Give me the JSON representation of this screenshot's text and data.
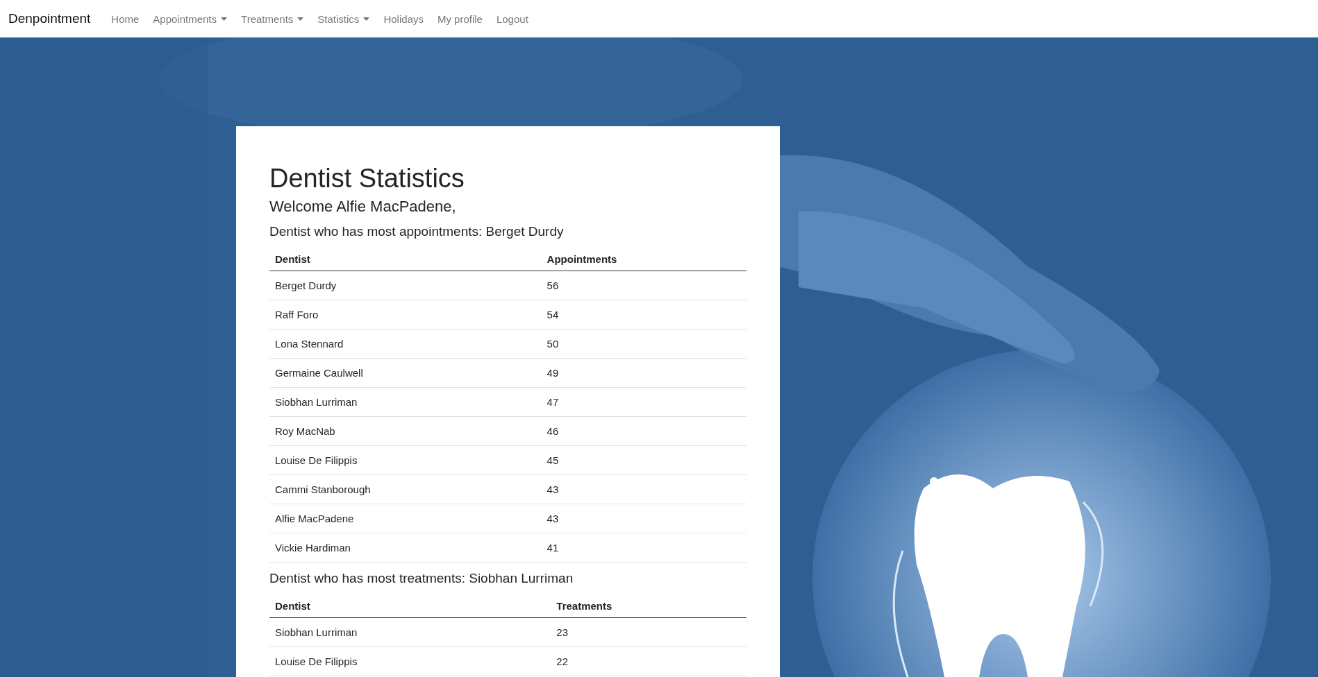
{
  "navbar": {
    "brand": "Denpointment",
    "items": [
      {
        "label": "Home",
        "dropdown": false
      },
      {
        "label": "Appointments",
        "dropdown": true
      },
      {
        "label": "Treatments",
        "dropdown": true
      },
      {
        "label": "Statistics",
        "dropdown": true
      },
      {
        "label": "Holidays",
        "dropdown": false
      },
      {
        "label": "My profile",
        "dropdown": false
      },
      {
        "label": "Logout",
        "dropdown": false
      }
    ]
  },
  "card": {
    "title": "Dentist Statistics",
    "welcome": "Welcome Alfie MacPadene,",
    "sections": [
      {
        "heading": "Dentist who has most appointments: Berget Durdy",
        "columns": [
          "Dentist",
          "Appointments"
        ],
        "rows": [
          [
            "Berget Durdy",
            "56"
          ],
          [
            "Raff Foro",
            "54"
          ],
          [
            "Lona Stennard",
            "50"
          ],
          [
            "Germaine Caulwell",
            "49"
          ],
          [
            "Siobhan Lurriman",
            "47"
          ],
          [
            "Roy MacNab",
            "46"
          ],
          [
            "Louise De Filippis",
            "45"
          ],
          [
            "Cammi Stanborough",
            "43"
          ],
          [
            "Alfie MacPadene",
            "43"
          ],
          [
            "Vickie Hardiman",
            "41"
          ]
        ]
      },
      {
        "heading": "Dentist who has most treatments: Siobhan Lurriman",
        "columns": [
          "Dentist",
          "Treatments"
        ],
        "rows": [
          [
            "Siobhan Lurriman",
            "23"
          ],
          [
            "Louise De Filippis",
            "22"
          ]
        ]
      }
    ]
  }
}
